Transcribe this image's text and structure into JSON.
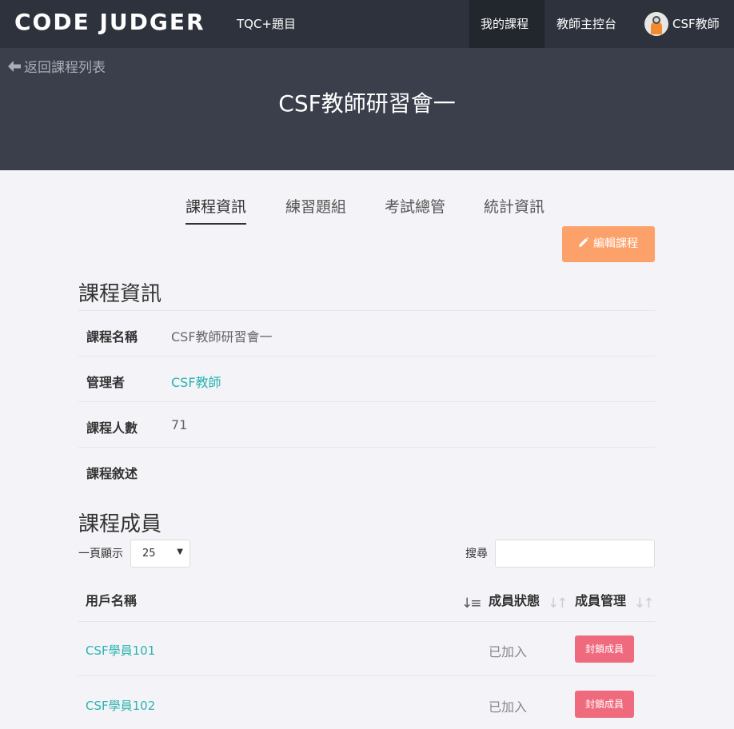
{
  "navbar": {
    "brand": "CODE JUDGER",
    "link_tqc": "TQC+題目",
    "link_my_courses": "我的課程",
    "link_console": "教師主控台",
    "user_name": "CSF教師"
  },
  "hero": {
    "back_label": "返回課程列表",
    "course_title": "CSF教師研習會一"
  },
  "tabs": [
    {
      "label": "課程資訊",
      "active": true
    },
    {
      "label": "練習題組",
      "active": false
    },
    {
      "label": "考試總管",
      "active": false
    },
    {
      "label": "統計資訊",
      "active": false
    }
  ],
  "edit_button": "編輯課程",
  "info": {
    "title": "課程資訊",
    "rows": [
      {
        "label": "課程名稱",
        "value": "CSF教師研習會一"
      },
      {
        "label": "管理者",
        "value": "CSF教師"
      },
      {
        "label": "課程人數",
        "value": "71"
      },
      {
        "label": "課程敘述",
        "value": ""
      }
    ]
  },
  "members": {
    "title": "課程成員",
    "per_page_label": "一頁顯示",
    "per_page_value": "25",
    "search_label": "搜尋",
    "search_value": "",
    "columns": [
      "用戶名稱",
      "成員狀態",
      "成員管理"
    ],
    "rows": [
      {
        "name": "CSF學員101",
        "status": "已加入",
        "action": "封鎖成員"
      },
      {
        "name": "CSF學員102",
        "status": "已加入",
        "action": "封鎖成員"
      }
    ]
  },
  "colors": {
    "navbar": "#2d323c",
    "hero": "#3a3f4b",
    "link": "#2bb3b0",
    "edit_button": "#fda16a",
    "block_button": "#f06a7d"
  },
  "icons": [
    "arrow-left-icon",
    "pencil-icon",
    "sort-icon",
    "caret-down-icon",
    "user-avatar"
  ]
}
